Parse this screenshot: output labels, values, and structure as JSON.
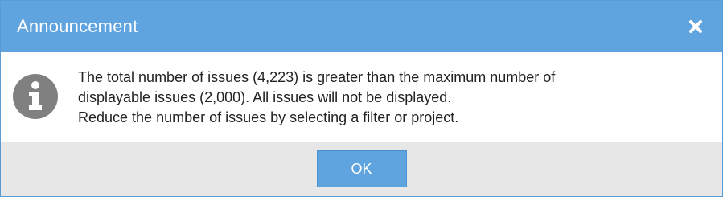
{
  "dialog": {
    "title": "Announcement",
    "close_icon": "close-icon",
    "info_icon": "info-icon",
    "message_lines": [
      "The total number of issues (4,223) is greater than the maximum number of",
      "displayable issues (2,000). All issues will not be displayed.",
      "Reduce the number of issues by selecting a filter or project."
    ],
    "ok_label": "OK"
  },
  "colors": {
    "titlebar": "#5fa3df",
    "button": "#5fa3df",
    "footer": "#e7e7e7",
    "icon": "#808080"
  }
}
